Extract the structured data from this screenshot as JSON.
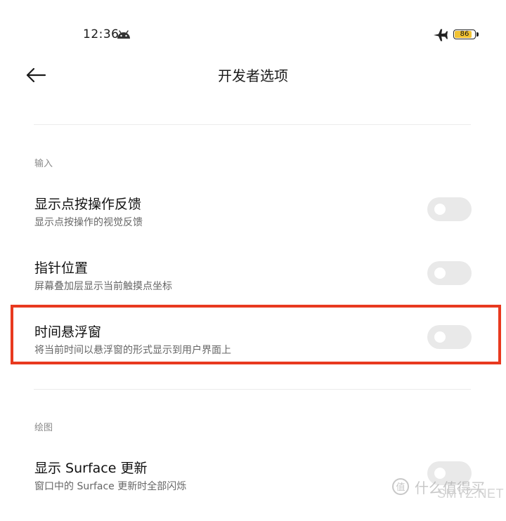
{
  "status_bar": {
    "time": "12:36",
    "battery_level": "86",
    "battery_fraction": 0.86,
    "icons": [
      "android-icon",
      "airplane-mode-icon",
      "battery-icon"
    ]
  },
  "header": {
    "title": "开发者选项",
    "back_icon": "back-arrow-icon"
  },
  "sections": [
    {
      "label": "输入",
      "items": [
        {
          "title": "显示点按操作反馈",
          "description": "显示点按操作的视觉反馈",
          "enabled": false
        },
        {
          "title": "指针位置",
          "description": "屏幕叠加层显示当前触摸点坐标",
          "enabled": false
        },
        {
          "title": "时间悬浮窗",
          "description": "将当前时间以悬浮窗的形式显示到用户界面上",
          "enabled": false,
          "highlighted": true
        }
      ]
    },
    {
      "label": "绘图",
      "items": [
        {
          "title": "显示 Surface 更新",
          "description": "窗口中的 Surface 更新时全部闪烁",
          "enabled": false
        }
      ]
    }
  ],
  "colors": {
    "highlight_border": "#e8391f",
    "toggle_off": "#e9e9e9",
    "battery_fill": "#f1c232"
  },
  "watermark": {
    "text": "什么值得买",
    "site": "SMYZ.NET"
  }
}
